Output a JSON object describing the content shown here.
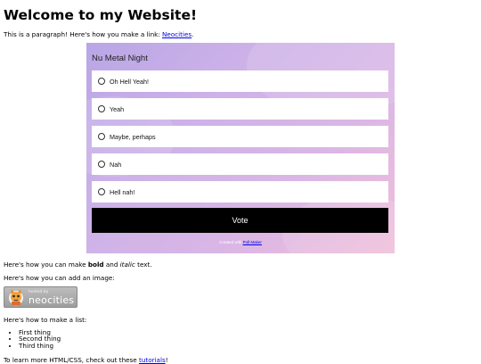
{
  "heading": "Welcome to my Website!",
  "intro": {
    "text": "This is a paragraph! Here's how you make a link: ",
    "link": "Neocities",
    "after": "."
  },
  "poll": {
    "title": "Nu Metal Night",
    "options": [
      "Oh Hell Yeah!",
      "Yeah",
      "Maybe, perhaps",
      "Nah",
      "Hell nah!"
    ],
    "vote_label": "Vote",
    "credit_text": "Created with ",
    "credit_link": "Poll Maker"
  },
  "bold_line": {
    "pre": "Here's how you can make ",
    "bold": "bold",
    "mid": " and ",
    "italic": "italic",
    "post": " text."
  },
  "image_line": "Here's how you can add an image:",
  "badge": {
    "small": "hosted by",
    "big": "neocities"
  },
  "list_line": "Here's how to make a list:",
  "list": [
    "First thing",
    "Second thing",
    "Third thing"
  ],
  "footer": {
    "text": "To learn more HTML/CSS, check out these ",
    "link": "tutorials",
    "after": "!"
  },
  "colors": {
    "link": "#0000ee",
    "vote_bg": "#000000",
    "poll_gradient": [
      "#b9a6e6",
      "#f0bfd9"
    ]
  }
}
